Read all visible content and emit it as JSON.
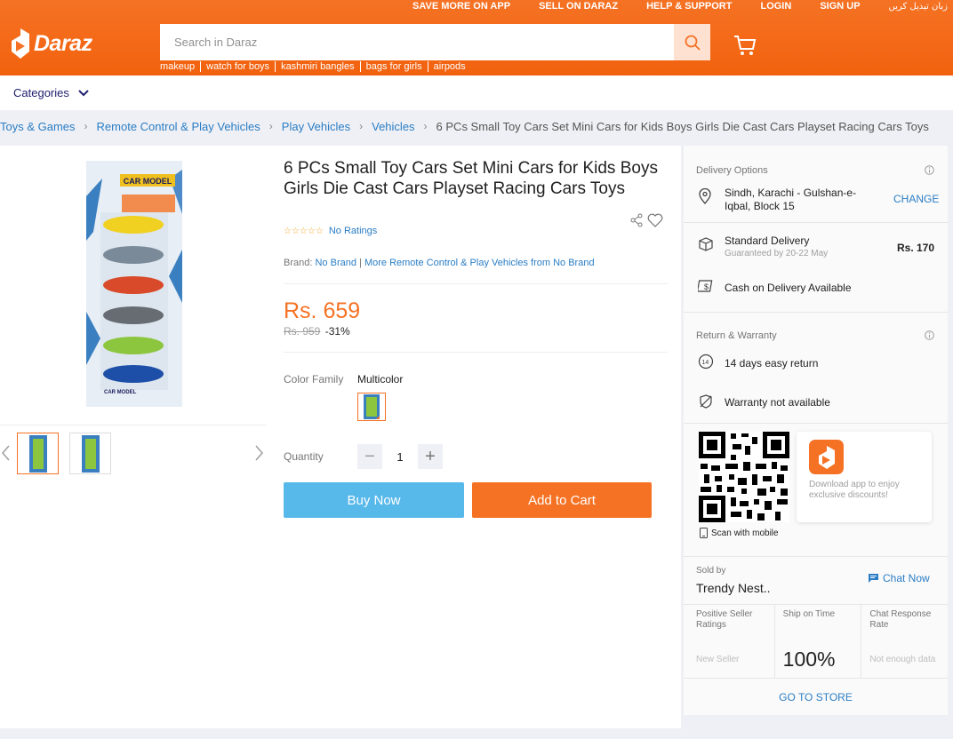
{
  "header": {
    "top_links": [
      "SAVE MORE ON APP",
      "SELL ON DARAZ",
      "HELP & SUPPORT",
      "LOGIN",
      "SIGN UP"
    ],
    "language": "زبان تبدیل کریں",
    "logo": "Daraz",
    "search_placeholder": "Search in Daraz",
    "suggestions": [
      "makeup",
      "watch for boys",
      "kashmiri bangles",
      "bags for girls",
      "airpods"
    ],
    "accent_color": "#f57224"
  },
  "categories_label": "Categories",
  "breadcrumb": [
    "Toys & Games",
    "Remote Control & Play Vehicles",
    "Play Vehicles",
    "Vehicles"
  ],
  "breadcrumb_current": "6 PCs Small Toy Cars Set Mini Cars for Kids Boys Girls Die Cast Cars Playset Racing Cars Toys",
  "product": {
    "title": "6 PCs Small Toy Cars Set Mini Cars for Kids Boys Girls Die Cast Cars Playset Racing Cars Toys",
    "image_label": "CAR MODEL",
    "rating_text": "No Ratings",
    "brand_label": "Brand:",
    "brand": "No Brand",
    "more_from": "More Remote Control & Play Vehicles from No Brand",
    "price": "Rs. 659",
    "old_price": "Rs. 959",
    "discount": "-31%",
    "color_label": "Color Family",
    "color_value": "Multicolor",
    "quantity_label": "Quantity",
    "quantity": "1",
    "buy_now": "Buy Now",
    "add_to_cart": "Add to Cart"
  },
  "delivery": {
    "heading": "Delivery Options",
    "location": "Sindh, Karachi - Gulshan-e-Iqbal, Block 15",
    "change": "CHANGE",
    "standard": "Standard Delivery",
    "guaranteed": "Guaranteed by 20-22 May",
    "fee": "Rs. 170",
    "cod": "Cash on Delivery Available"
  },
  "returns": {
    "heading": "Return & Warranty",
    "return_days": "14 days easy return",
    "warranty": "Warranty not available"
  },
  "app": {
    "scan": "Scan with mobile",
    "promo": "Download app to enjoy exclusive discounts!"
  },
  "seller": {
    "sold_by": "Sold by",
    "name": "Trendy Nest..",
    "chat": "Chat Now",
    "metrics": [
      {
        "label": "Positive Seller Ratings",
        "value": "New Seller"
      },
      {
        "label": "Ship on Time",
        "value": "100%"
      },
      {
        "label": "Chat Response Rate",
        "value": "Not enough data"
      }
    ],
    "go_to_store": "GO TO STORE"
  }
}
